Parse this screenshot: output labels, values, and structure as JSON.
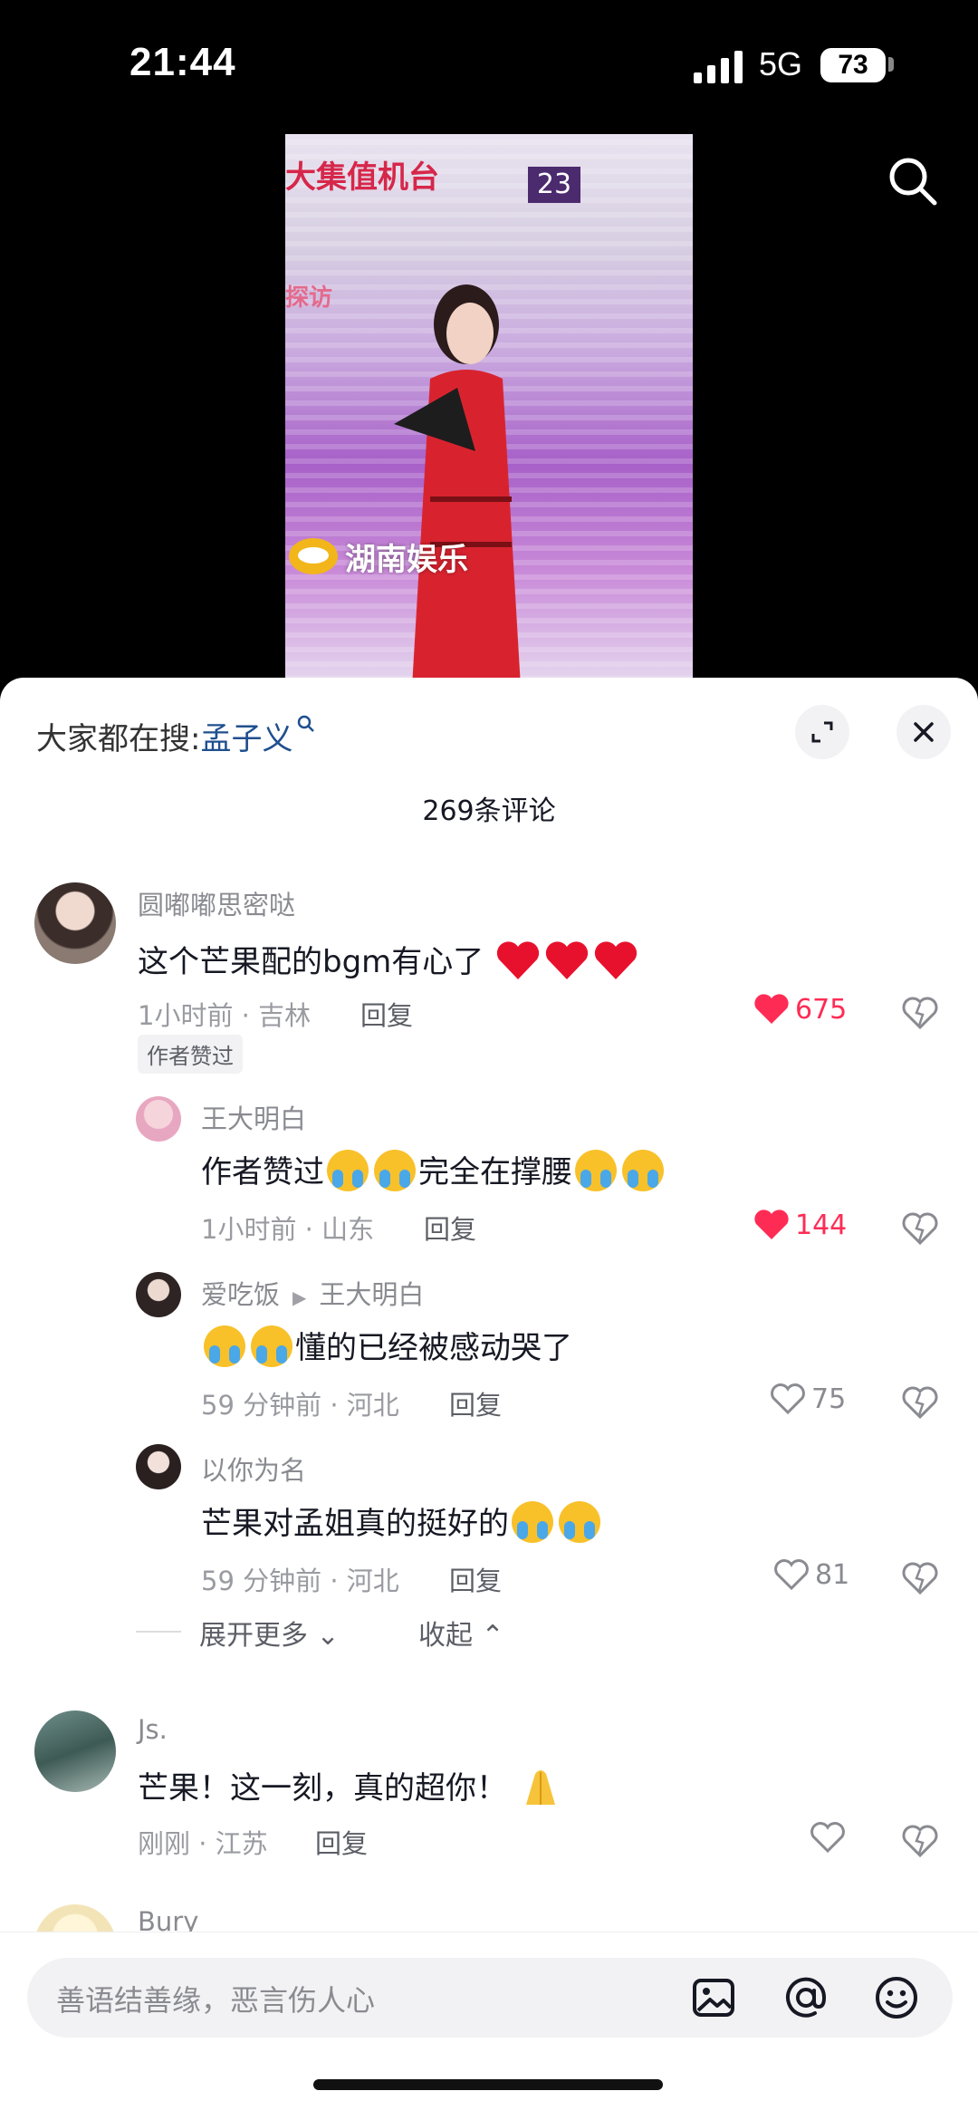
{
  "status_bar": {
    "time": "21:44",
    "network": "5G",
    "battery": "73"
  },
  "video": {
    "sign_text": "大集值机台",
    "sign_text_2": "探访",
    "number": "23",
    "watermark": "湖南娱乐"
  },
  "sheet": {
    "hot_search_prefix": "大家都在搜:",
    "hot_search_keyword": "孟子义",
    "comment_count": "269条评论"
  },
  "comments": [
    {
      "user": "圆嘟嘟思密哒",
      "text": "这个芒果配的bgm有心了",
      "time_location": "1小时前 · 吉林",
      "reply": "回复",
      "likes": "675",
      "liked": true,
      "tag": "作者赞过"
    },
    {
      "user": "王大明白",
      "text_a": "作者赞过",
      "text_b": "完全在撑腰",
      "time_location": "1小时前 · 山东",
      "reply": "回复",
      "likes": "144",
      "liked": true
    },
    {
      "user": "爱吃饭",
      "reply_to": "王大明白",
      "text": "懂的已经被感动哭了",
      "time_location": "59 分钟前 · 河北",
      "reply": "回复",
      "likes": "75",
      "liked": false
    },
    {
      "user": "以你为名",
      "text": "芒果对孟姐真的挺好的",
      "time_location": "59 分钟前 · 河北",
      "reply": "回复",
      "likes": "81",
      "liked": false
    },
    {
      "user": "Js.",
      "text": "芒果！这一刻，真的超你！",
      "time_location": "刚刚 · 江苏",
      "reply": "回复",
      "likes": "",
      "liked": false
    },
    {
      "user": "Bury"
    }
  ],
  "replies_controls": {
    "expand_more": "展开更多",
    "collapse": "收起"
  },
  "input": {
    "placeholder": "善语结善缘，恶言伤人心"
  },
  "colors": {
    "like_red": "#fe2c55",
    "link_blue": "#1f4f8f",
    "sheet_bg": "#ffffff"
  }
}
